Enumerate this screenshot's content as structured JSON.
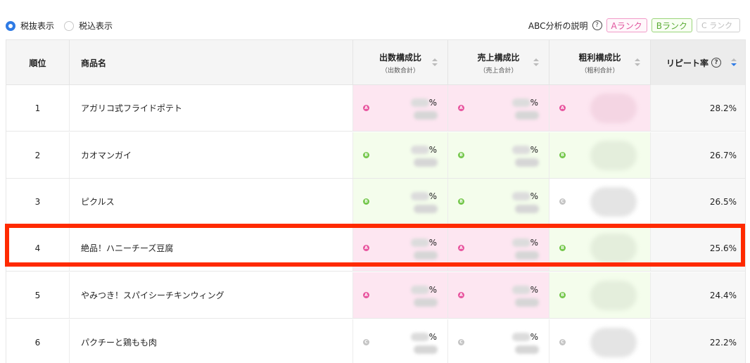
{
  "tax_toggle": {
    "options": [
      {
        "label": "税抜表示",
        "selected": true
      },
      {
        "label": "税込表示",
        "selected": false
      }
    ]
  },
  "abc": {
    "explain_label": "ABC分析の説明",
    "help_icon": "?",
    "rank_a": "Aランク",
    "rank_b": "Bランク",
    "rank_c": "C ランク"
  },
  "table": {
    "headers": {
      "rank": "順位",
      "name": "商品名",
      "qty_ratio": "出数構成比",
      "qty_ratio_sub": "（出数合計）",
      "sales_ratio": "売上構成比",
      "sales_ratio_sub": "（売上合計）",
      "profit_ratio": "粗利構成比",
      "profit_ratio_sub": "（粗利合計）",
      "repeat_rate": "リピート率"
    },
    "rows": [
      {
        "rank": "1",
        "name": "アガリコ式フライドポテト",
        "qty_rank": "A",
        "sales_rank": "A",
        "profit_rank": "A",
        "pct": "%",
        "repeat": "28.2%"
      },
      {
        "rank": "2",
        "name": "カオマンガイ",
        "qty_rank": "B",
        "sales_rank": "B",
        "profit_rank": "B",
        "pct": "%",
        "repeat": "26.7%"
      },
      {
        "rank": "3",
        "name": "ピクルス",
        "qty_rank": "B",
        "sales_rank": "B",
        "profit_rank": "C",
        "pct": "%",
        "repeat": "26.5%"
      },
      {
        "rank": "4",
        "name": "絶品！ハニーチーズ豆腐",
        "qty_rank": "A",
        "sales_rank": "A",
        "profit_rank": "B",
        "pct": "%",
        "repeat": "25.6%"
      },
      {
        "rank": "5",
        "name": "やみつき！スパイシーチキンウィング",
        "qty_rank": "A",
        "sales_rank": "A",
        "profit_rank": "B",
        "pct": "%",
        "repeat": "24.4%"
      },
      {
        "rank": "6",
        "name": "パクチーと鶏もも肉",
        "qty_rank": "C",
        "sales_rank": "C",
        "profit_rank": "C",
        "pct": "%",
        "repeat": "22.2%"
      }
    ]
  },
  "colors": {
    "accent": "#2f7be5",
    "rank_a_bg": "#fde6f1",
    "rank_b_bg": "#f4fdec",
    "highlight": "#ff2a00"
  }
}
